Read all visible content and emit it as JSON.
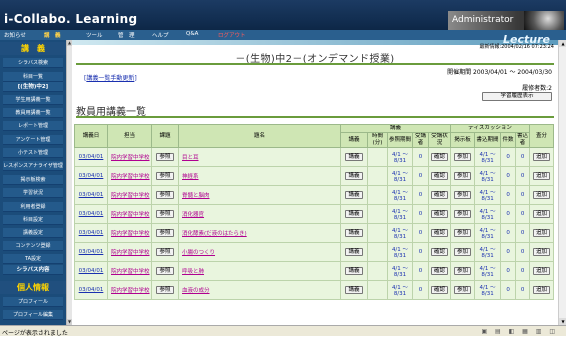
{
  "header": {
    "logo": "i-Collabo. Learning",
    "user": "Administrator"
  },
  "menubar": {
    "items": [
      "お知らせ",
      "講　義",
      "ツール",
      "管　理",
      "ヘルプ",
      "Q&A",
      "ログアウト"
    ]
  },
  "sidebar": {
    "section1_title": "講　義",
    "items": [
      "シラバス検索",
      "科目一覧",
      "[(生物)中2]",
      "学生用講義一覧",
      "教員用講義一覧",
      "レポート管理",
      "アンケート管理",
      "小テスト管理",
      "レスポンスアナライザ管理",
      "掲示板検索",
      "学習状況",
      "利用者登録",
      "科目設定",
      "講義設定",
      "コンテンツ登録",
      "TA設定",
      "シラバス内容"
    ],
    "section2_title": "個人情報",
    "items2": [
      "プロフィール",
      "プロフィール編集"
    ]
  },
  "main": {
    "lecture_label": "Lecture",
    "update": "最新情報:2004/02/16 07:23:24",
    "title": "－(生物)中2－(オンデマンド授業)",
    "period": "開催期間 2003/04/01 ～ 2004/03/30",
    "list_link_prefix": "[",
    "list_link": "講義一覧手動更新",
    "list_link_suffix": "]",
    "history_count": "履修者数:2",
    "history_button": "学習履歴表示",
    "section_title": "教員用講義一覧"
  },
  "table": {
    "headers": {
      "date": "講義日",
      "teacher": "担当",
      "assignment": "課題",
      "subject": "題名",
      "lecture_group": "講義",
      "lecture": "講義",
      "time": "時間(分)",
      "period": "参照期間",
      "viewers": "受講者",
      "status": "受講状況",
      "discussion_group": "ディスカッション",
      "board": "掲示板",
      "write_period": "書込期間",
      "count": "件数",
      "writers": "書込者",
      "exam": "査分"
    },
    "buttons": {
      "ref": "参照",
      "lecture": "講義",
      "confirm": "確認",
      "join": "参加",
      "add": "追加"
    },
    "rows": [
      {
        "date": "03/04/01",
        "teacher": "院内学習中学校",
        "subject": "目と耳",
        "period": "4/1 ～ 8/31",
        "viewers": "0",
        "write_period": "4/1 ～ 8/31",
        "count": "0",
        "writers": "0"
      },
      {
        "date": "03/04/01",
        "teacher": "院内学習中学校",
        "subject": "神経系",
        "period": "4/1 ～ 8/31",
        "viewers": "0",
        "write_period": "4/1 ～ 8/31",
        "count": "0",
        "writers": "0"
      },
      {
        "date": "03/04/01",
        "teacher": "院内学習中学校",
        "subject": "脊髄と脳肉",
        "period": "4/1 ～ 8/31",
        "viewers": "0",
        "write_period": "4/1 ～ 8/31",
        "count": "0",
        "writers": "0"
      },
      {
        "date": "03/04/01",
        "teacher": "院内学習中学校",
        "subject": "消化器官",
        "period": "4/1 ～ 8/31",
        "viewers": "0",
        "write_period": "4/1 ～ 8/31",
        "count": "0",
        "writers": "0"
      },
      {
        "date": "03/04/01",
        "teacher": "院内学習中学校",
        "subject": "消化酵素(だ液のはたらき)",
        "period": "4/1 ～ 8/31",
        "viewers": "0",
        "write_period": "4/1 ～ 8/31",
        "count": "0",
        "writers": "0"
      },
      {
        "date": "03/04/01",
        "teacher": "院内学習中学校",
        "subject": "小腸のつくり",
        "period": "4/1 ～ 8/31",
        "viewers": "0",
        "write_period": "4/1 ～ 8/31",
        "count": "0",
        "writers": "0"
      },
      {
        "date": "03/04/01",
        "teacher": "院内学習中学校",
        "subject": "呼吸と肺",
        "period": "4/1 ～ 8/31",
        "viewers": "0",
        "write_period": "4/1 ～ 8/31",
        "count": "0",
        "writers": "0"
      },
      {
        "date": "03/04/01",
        "teacher": "院内学習中学校",
        "subject": "血液の成分",
        "period": "4/1 ～ 8/31",
        "viewers": "0",
        "write_period": "4/1 ～ 8/31",
        "count": "0",
        "writers": "0"
      }
    ]
  },
  "status_bar": {
    "text": "ページが表示されました"
  }
}
